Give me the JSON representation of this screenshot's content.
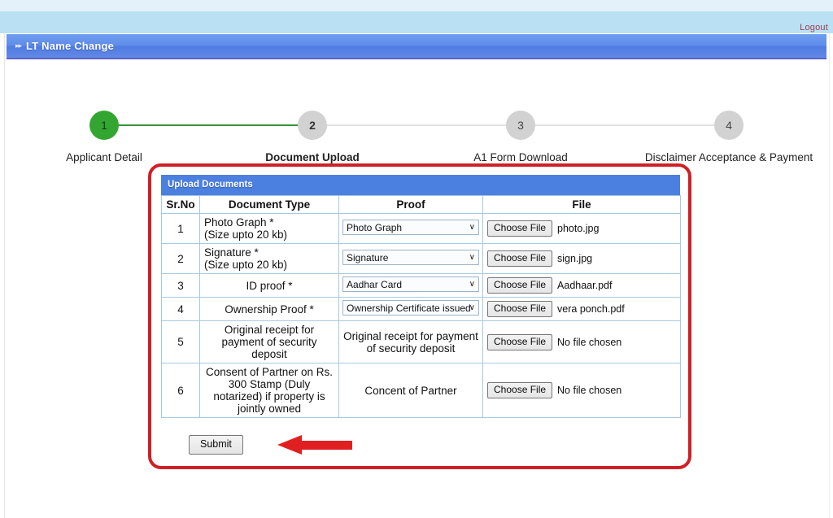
{
  "topbar": {
    "logout_label": "Logout"
  },
  "section": {
    "bullet": "▸▸",
    "title": "LT Name Change"
  },
  "stepper": {
    "steps": [
      {
        "number": "1",
        "label": "Applicant Detail",
        "state": "done"
      },
      {
        "number": "2",
        "label": "Document Upload",
        "state": "current"
      },
      {
        "number": "3",
        "label": "A1 Form Download",
        "state": "todo"
      },
      {
        "number": "4",
        "label": "Disclaimer Acceptance & Payment",
        "state": "todo"
      }
    ],
    "active_color": "#33a632",
    "inactive_color": "#d2d2d2",
    "connector_done_color": "#3f8f3c",
    "connector_todo_color": "#e2e2e2"
  },
  "upload_panel": {
    "panel_title": "Upload Documents",
    "panel_title_bg": "#4b7fe0",
    "highlight_border_color": "#cf2026",
    "columns": [
      "Sr.No",
      "Document Type",
      "Proof",
      "File"
    ],
    "rows": [
      {
        "sr": "1",
        "doc_type": "Photo Graph *\n(Size upto 20 kb)",
        "doc_type_align": "left",
        "proof_kind": "select",
        "proof_value": "Photo Graph",
        "file_button": "Choose File",
        "file_name": "photo.jpg"
      },
      {
        "sr": "2",
        "doc_type": "Signature *\n(Size upto 20 kb)",
        "doc_type_align": "left",
        "proof_kind": "select",
        "proof_value": "Signature",
        "file_button": "Choose File",
        "file_name": "sign.jpg"
      },
      {
        "sr": "3",
        "doc_type": "ID proof *",
        "doc_type_align": "center",
        "proof_kind": "select",
        "proof_value": "Aadhar Card",
        "file_button": "Choose File",
        "file_name": "Aadhaar.pdf"
      },
      {
        "sr": "4",
        "doc_type": "Ownership Proof *",
        "doc_type_align": "center",
        "proof_kind": "select",
        "proof_value": "Ownership Certificate issued",
        "file_button": "Choose File",
        "file_name": "vera ponch.pdf"
      },
      {
        "sr": "5",
        "doc_type": "Original receipt for payment of security deposit",
        "doc_type_align": "center",
        "proof_kind": "text",
        "proof_value": "Original receipt for payment of security deposit",
        "file_button": "Choose File",
        "file_name": "No file chosen"
      },
      {
        "sr": "6",
        "doc_type": "Consent of Partner on Rs. 300 Stamp (Duly notarized) if property is jointly owned",
        "doc_type_align": "center",
        "proof_kind": "text",
        "proof_value": "Concent of Partner",
        "file_button": "Choose File",
        "file_name": "No file chosen"
      }
    ],
    "submit_label": "Submit",
    "annotation_arrow": "red-left-arrow"
  }
}
